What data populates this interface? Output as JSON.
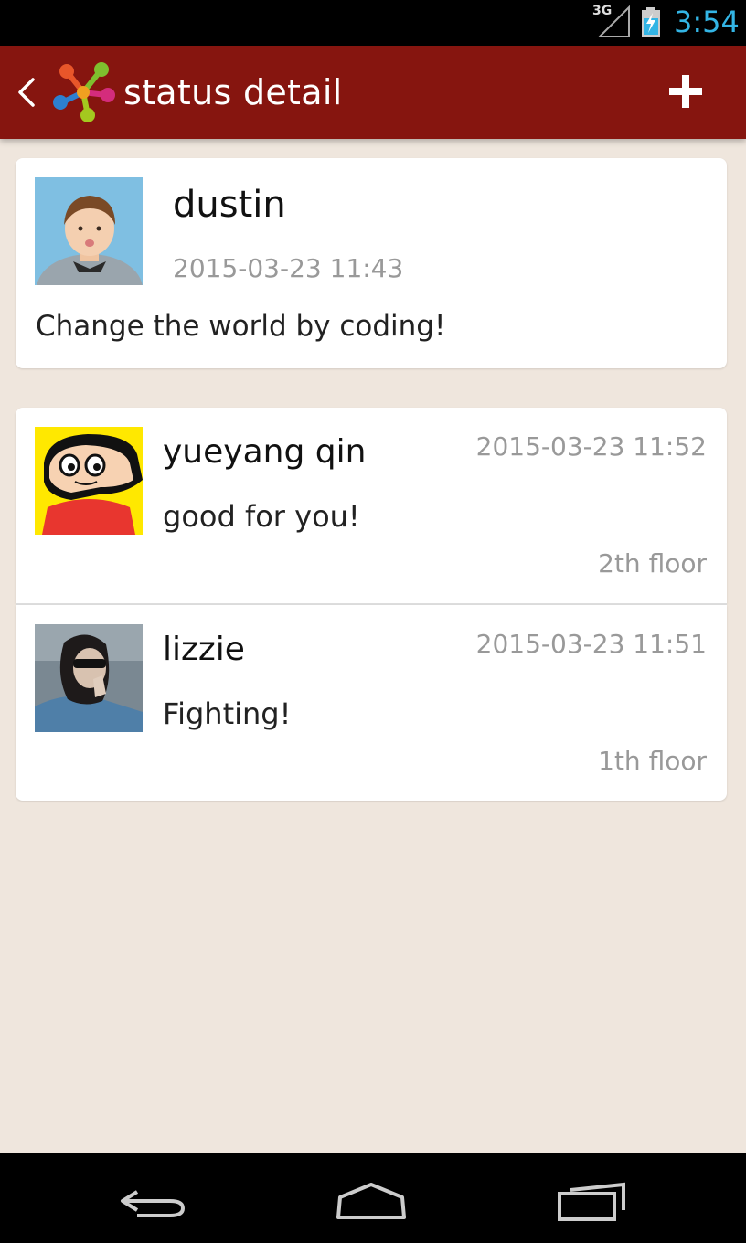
{
  "status_bar": {
    "network": "3G",
    "time": "3:54"
  },
  "action_bar": {
    "title": "status detail"
  },
  "post": {
    "author": "dustin",
    "time": "2015-03-23 11:43",
    "content": "Change the world by coding!"
  },
  "comments": [
    {
      "author": "yueyang qin",
      "time": "2015-03-23 11:52",
      "content": "good for you!",
      "floor": "2th floor"
    },
    {
      "author": "lizzie",
      "time": "2015-03-23 11:51",
      "content": "Fighting!",
      "floor": "1th floor"
    }
  ],
  "colors": {
    "action_bar": "#86150f",
    "background": "#efe6dd",
    "clock": "#33b5e5"
  },
  "icons": {
    "back": "chevron-left-icon",
    "logo": "app-logo-icon",
    "add": "plus-icon",
    "nav": [
      "nav-back-icon",
      "nav-home-icon",
      "nav-recent-apps-icon"
    ]
  }
}
